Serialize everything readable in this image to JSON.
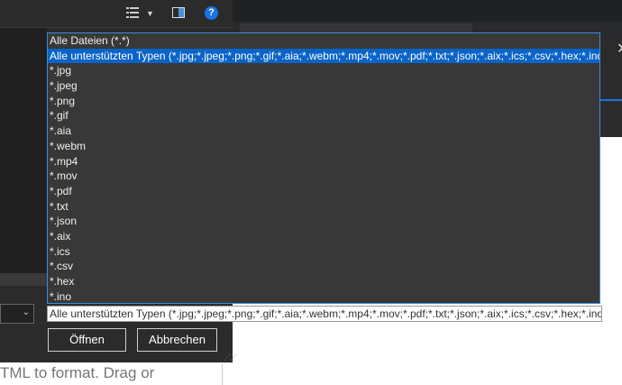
{
  "dropdown": {
    "options": [
      "Alle Dateien (*.*)",
      "Alle unterstützten Typen (*.jpg;*.jpeg;*.png;*.gif;*.aia;*.webm;*.mp4;*.mov;*.pdf;*.txt;*.json;*.aix;*.ics;*.csv;*.hex;*.ino)",
      "*.jpg",
      "*.jpeg",
      "*.png",
      "*.gif",
      "*.aia",
      "*.webm",
      "*.mp4",
      "*.mov",
      "*.pdf",
      "*.txt",
      "*.json",
      "*.aix",
      "*.ics",
      "*.csv",
      "*.hex",
      "*.ino"
    ],
    "selected_index": 1
  },
  "combo": {
    "value": "Alle unterstützten Typen (*.jpg;*.jpeg;*.png;*.gif;*.aia;*.webm;*.mp4;*.mov;*.pdf;*.txt;*.json;*.aix;*.ics;*.csv;*.hex;*.ino)"
  },
  "buttons": {
    "open": "Öffnen",
    "cancel": "Abbrechen"
  },
  "toolbar": {
    "help": "?"
  },
  "editor": {
    "hint": "TML to format. Drag or"
  },
  "window": {
    "close_glyph": "✕"
  },
  "colors": {
    "selection": "#0a64c8",
    "accent": "#1a73e8",
    "dialog_bg": "#2b2b2b"
  }
}
